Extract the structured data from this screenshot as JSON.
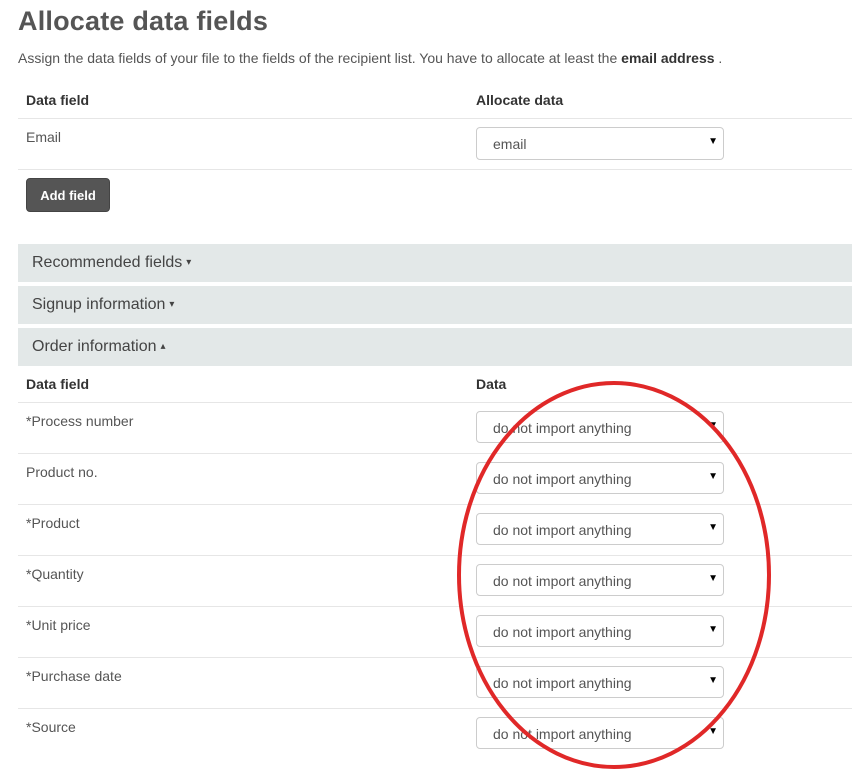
{
  "page": {
    "title": "Allocate data fields",
    "intro_text": "Assign the data fields of your file to the fields of the recipient list. You have to allocate at least the ",
    "intro_bold": "email address",
    "intro_end": " ."
  },
  "mapping_table": {
    "col_data_field": "Data field",
    "col_allocate": "Allocate data",
    "rows": [
      {
        "label": "Email",
        "value": "email"
      }
    ]
  },
  "add_field_button": "Add field",
  "panels": {
    "recommended": "Recommended fields",
    "signup": "Signup information",
    "order": "Order information"
  },
  "order_table": {
    "col_data_field": "Data field",
    "col_data": "Data",
    "rows": [
      {
        "label": "*Process number",
        "value": "do not import anything"
      },
      {
        "label": "Product no.",
        "value": "do not import anything"
      },
      {
        "label": "*Product",
        "value": "do not import anything"
      },
      {
        "label": "*Quantity",
        "value": "do not import anything"
      },
      {
        "label": "*Unit price",
        "value": "do not import anything"
      },
      {
        "label": "*Purchase date",
        "value": "do not import anything"
      },
      {
        "label": "*Source",
        "value": "do not import anything"
      }
    ]
  },
  "icons": {
    "caret_down": "▾",
    "caret_up": "▴",
    "select_arrow": "▼"
  },
  "colors": {
    "annotation": "#e02828",
    "panel_bg": "#e3e8e8",
    "button_bg": "#555555"
  }
}
